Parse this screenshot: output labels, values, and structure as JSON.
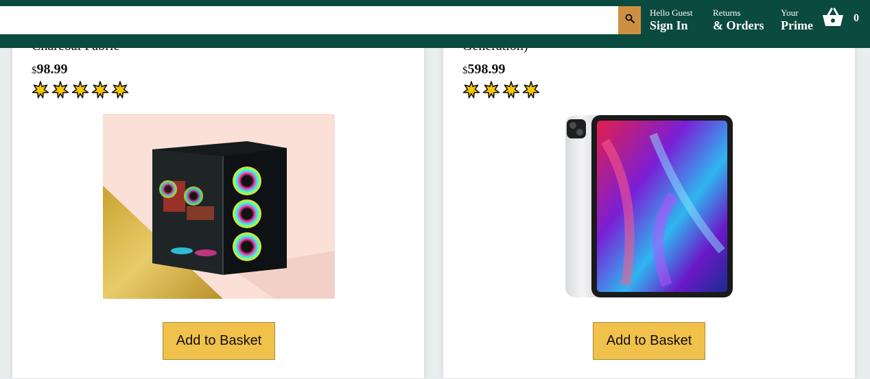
{
  "header": {
    "search": {
      "value": "",
      "placeholder": ""
    },
    "nav": {
      "signin": {
        "line1": "Hello Guest",
        "line2": "Sign In"
      },
      "orders": {
        "line1": "Returns",
        "line2": "& Orders"
      },
      "prime": {
        "line1": "Your",
        "line2": "Prime"
      }
    },
    "basket_count": "0"
  },
  "products": [
    {
      "title": "Charcoal Fabric",
      "currency": "$",
      "price": "98.99",
      "rating": 5,
      "button_label": "Add to Basket"
    },
    {
      "title": "Generation)",
      "currency": "$",
      "price": "598.99",
      "rating": 4,
      "button_label": "Add to Basket"
    }
  ],
  "colors": {
    "header_bg": "#0b4a3e",
    "search_button": "#cd9042",
    "add_button": "#f0c14b",
    "star_fill": "#f7c600"
  },
  "icons": {
    "search": "search-icon",
    "basket": "shopping-basket-icon",
    "star": "star-icon"
  }
}
